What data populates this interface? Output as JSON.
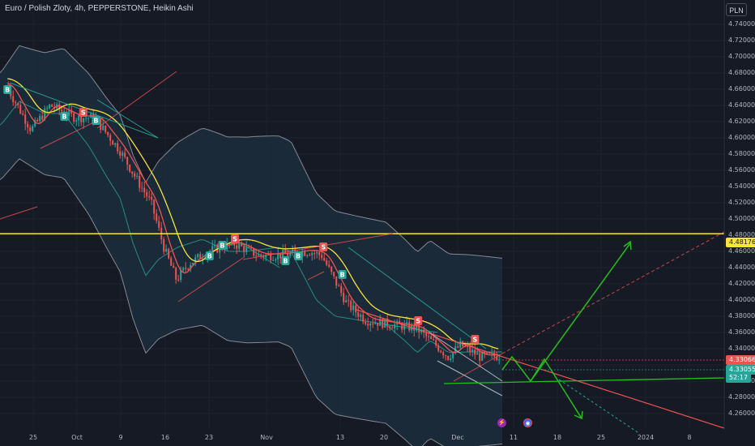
{
  "header": {
    "title": "Euro / Polish Zloty, 4h, PEPPERSTONE, Heikin Ashi",
    "currency_button": "PLN"
  },
  "price_labels": {
    "resistance": "4.48176",
    "last_close": "4.33066",
    "current": "4.33055",
    "countdown": "52:17"
  },
  "colors": {
    "background": "#161a25",
    "up_candle": "#26a69a",
    "down_candle": "#ef5350",
    "ma_fast": "#ef5350",
    "ma_slow": "#f7e43a",
    "ma_long": "#26a69a",
    "bollinger": "#b2b5be",
    "resistance_line": "#f7e43a",
    "projection": "#22c21a"
  },
  "events": [
    {
      "icon": "lightning-icon",
      "glyph": "⚡"
    },
    {
      "icon": "globe-icon",
      "glyph": "◉"
    }
  ],
  "chart_data": {
    "type": "candlestick",
    "symbol": "EURPLN",
    "style": "Heikin Ashi",
    "interval": "4h",
    "x_ticks": [
      "25",
      "Oct",
      "9",
      "16",
      "23",
      "Nov",
      "13",
      "20",
      "Dec",
      "11",
      "18",
      "25",
      "2024",
      "8"
    ],
    "y_ticks": [
      "4.74000",
      "4.72000",
      "4.70000",
      "4.68000",
      "4.66000",
      "4.64000",
      "4.62000",
      "4.60000",
      "4.58000",
      "4.56000",
      "4.54000",
      "4.52000",
      "4.50000",
      "4.48000",
      "4.46000",
      "4.44000",
      "4.42000",
      "4.40000",
      "4.38000",
      "4.36000",
      "4.34000",
      "4.32000",
      "4.30000",
      "4.28000",
      "4.26000"
    ],
    "ylim": [
      4.26,
      4.75
    ],
    "price_path": [
      {
        "x": "2023-09-21",
        "y": 4.665
      },
      {
        "x": "2023-09-25",
        "y": 4.61
      },
      {
        "x": "2023-09-28",
        "y": 4.64
      },
      {
        "x": "2023-10-02",
        "y": 4.625
      },
      {
        "x": "2023-10-05",
        "y": 4.625
      },
      {
        "x": "2023-10-09",
        "y": 4.585
      },
      {
        "x": "2023-10-12",
        "y": 4.545
      },
      {
        "x": "2023-10-14",
        "y": 4.52
      },
      {
        "x": "2023-10-16",
        "y": 4.465
      },
      {
        "x": "2023-10-18",
        "y": 4.425
      },
      {
        "x": "2023-10-20",
        "y": 4.445
      },
      {
        "x": "2023-10-23",
        "y": 4.46
      },
      {
        "x": "2023-10-27",
        "y": 4.47
      },
      {
        "x": "2023-10-31",
        "y": 4.455
      },
      {
        "x": "2023-11-03",
        "y": 4.455
      },
      {
        "x": "2023-11-08",
        "y": 4.46
      },
      {
        "x": "2023-11-10",
        "y": 4.455
      },
      {
        "x": "2023-11-14",
        "y": 4.395
      },
      {
        "x": "2023-11-17",
        "y": 4.375
      },
      {
        "x": "2023-11-21",
        "y": 4.37
      },
      {
        "x": "2023-11-25",
        "y": 4.365
      },
      {
        "x": "2023-11-28",
        "y": 4.345
      },
      {
        "x": "2023-11-30",
        "y": 4.33
      },
      {
        "x": "2023-12-02",
        "y": 4.345
      },
      {
        "x": "2023-12-05",
        "y": 4.33
      },
      {
        "x": "2023-12-08",
        "y": 4.331
      }
    ],
    "signals": [
      {
        "label": "B",
        "x": "2023-09-21",
        "y": 4.66,
        "type": "buy"
      },
      {
        "label": "B",
        "x": "2023-09-30",
        "y": 4.627,
        "type": "buy"
      },
      {
        "label": "S",
        "x": "2023-10-03",
        "y": 4.632,
        "type": "sell"
      },
      {
        "label": "B",
        "x": "2023-10-05",
        "y": 4.622,
        "type": "buy"
      },
      {
        "label": "B",
        "x": "2023-10-25",
        "y": 4.468,
        "type": "buy"
      },
      {
        "label": "B",
        "x": "2023-10-23",
        "y": 4.455,
        "type": "buy"
      },
      {
        "label": "S",
        "x": "2023-10-27",
        "y": 4.476,
        "type": "sell"
      },
      {
        "label": "B",
        "x": "2023-11-04",
        "y": 4.449,
        "type": "buy"
      },
      {
        "label": "B",
        "x": "2023-11-06",
        "y": 4.455,
        "type": "buy"
      },
      {
        "label": "S",
        "x": "2023-11-10",
        "y": 4.466,
        "type": "sell"
      },
      {
        "label": "B",
        "x": "2023-11-13",
        "y": 4.432,
        "type": "buy"
      },
      {
        "label": "S",
        "x": "2023-11-25",
        "y": 4.375,
        "type": "sell"
      },
      {
        "label": "S",
        "x": "2023-12-04",
        "y": 4.352,
        "type": "sell"
      }
    ],
    "horizontal_level": 4.48176,
    "grid": true
  }
}
